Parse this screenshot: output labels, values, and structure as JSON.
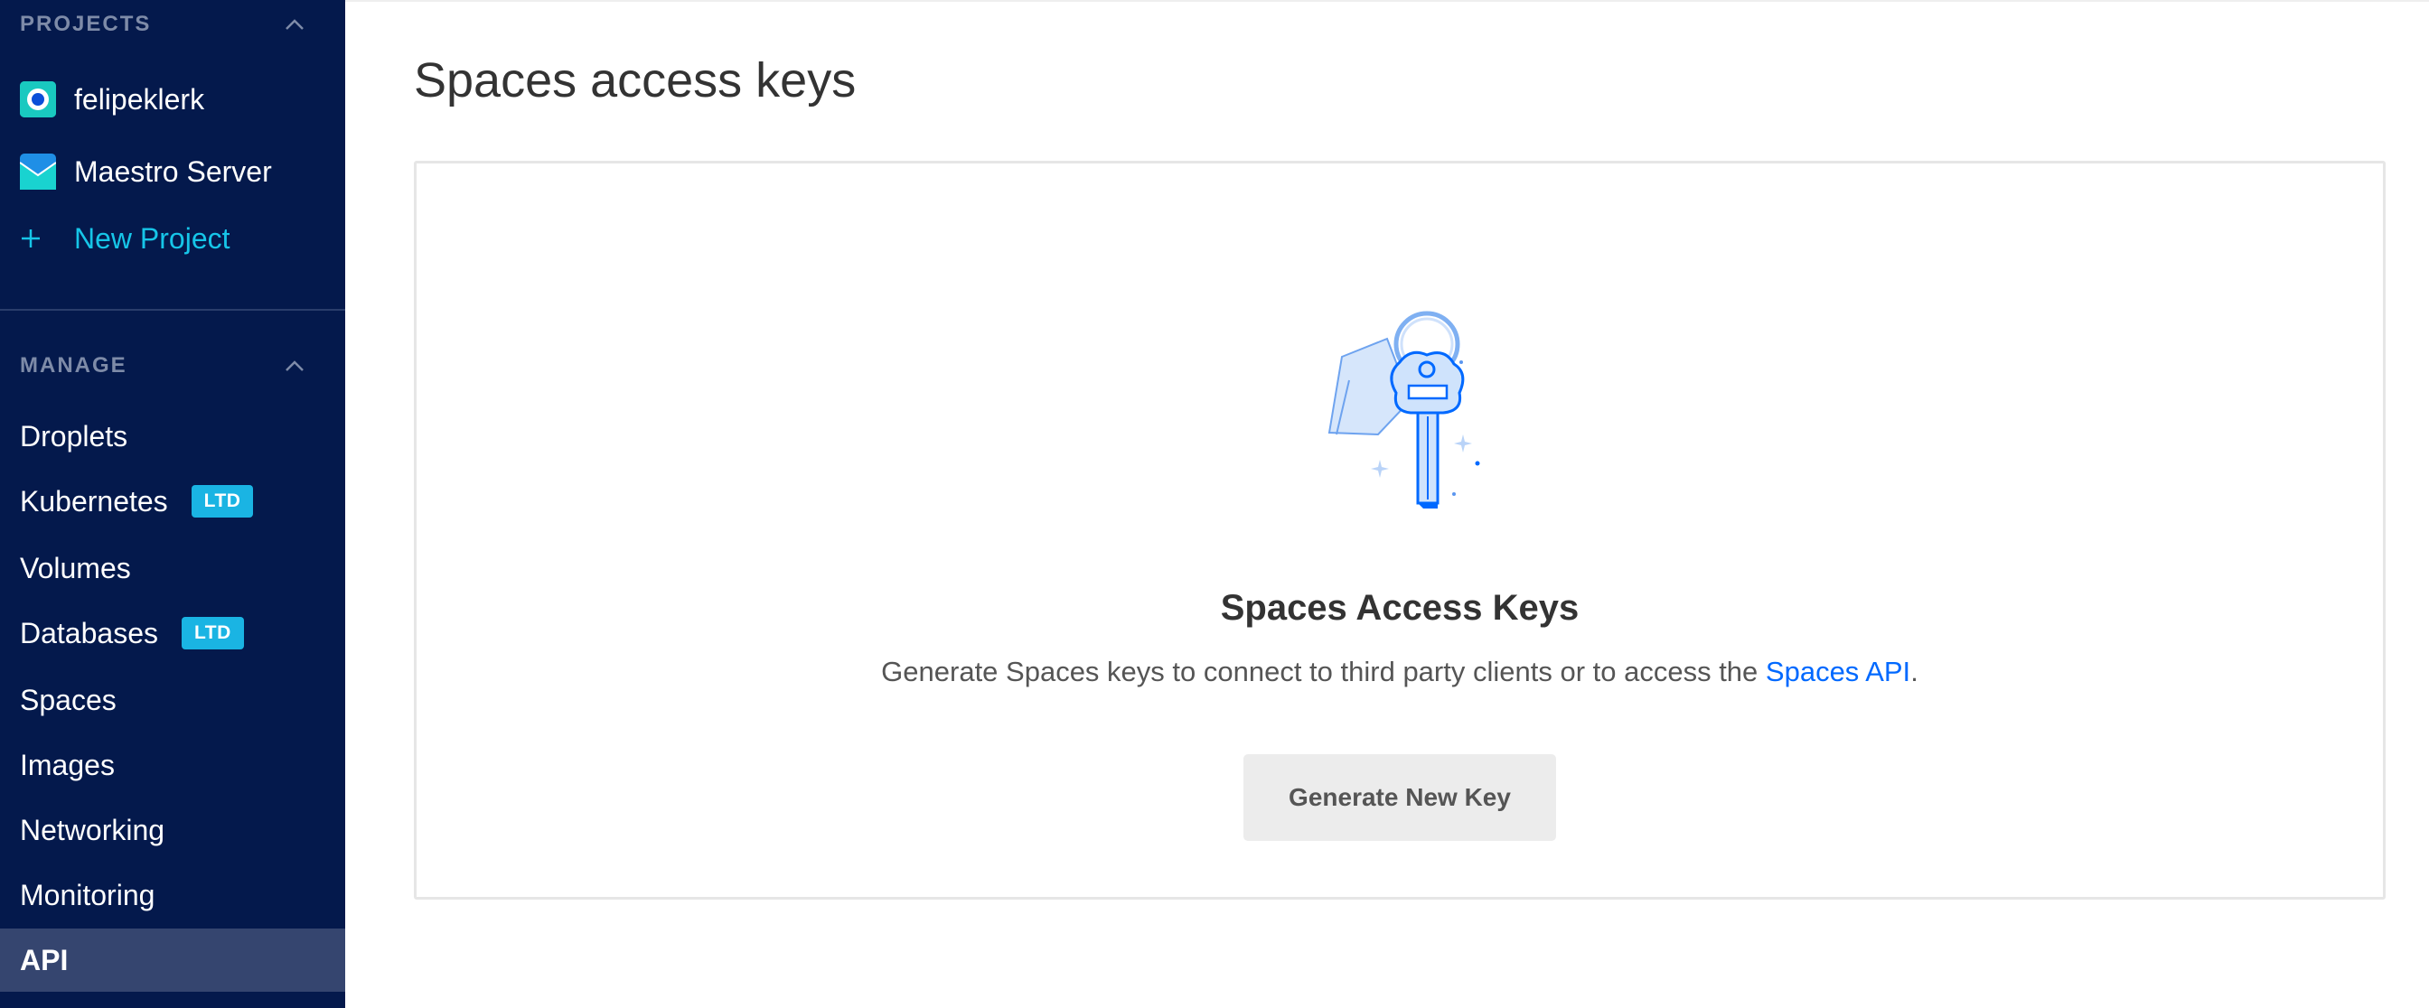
{
  "sidebar": {
    "projects_header": "PROJECTS",
    "projects": [
      {
        "label": "felipeklerk",
        "icon": "project-target-icon"
      },
      {
        "label": "Maestro Server",
        "icon": "project-envelope-icon"
      }
    ],
    "new_project_label": "New Project",
    "manage_header": "MANAGE",
    "nav": [
      {
        "label": "Droplets",
        "badge": null
      },
      {
        "label": "Kubernetes",
        "badge": "LTD"
      },
      {
        "label": "Volumes",
        "badge": null
      },
      {
        "label": "Databases",
        "badge": "LTD"
      },
      {
        "label": "Spaces",
        "badge": null
      },
      {
        "label": "Images",
        "badge": null
      },
      {
        "label": "Networking",
        "badge": null
      },
      {
        "label": "Monitoring",
        "badge": null
      },
      {
        "label": "API",
        "badge": null,
        "active": true
      }
    ]
  },
  "main": {
    "page_title": "Spaces access keys",
    "card": {
      "title": "Spaces Access Keys",
      "description_prefix": "Generate Spaces keys to connect to third party clients or to access the ",
      "description_link": "Spaces API",
      "description_suffix": ".",
      "button_label": "Generate New Key"
    }
  },
  "colors": {
    "sidebar_bg": "#04194c",
    "active_bg": "#35456f",
    "accent_cyan": "#16c5e8",
    "badge_bg": "#1ab4e3",
    "link_blue": "#0069ff"
  }
}
